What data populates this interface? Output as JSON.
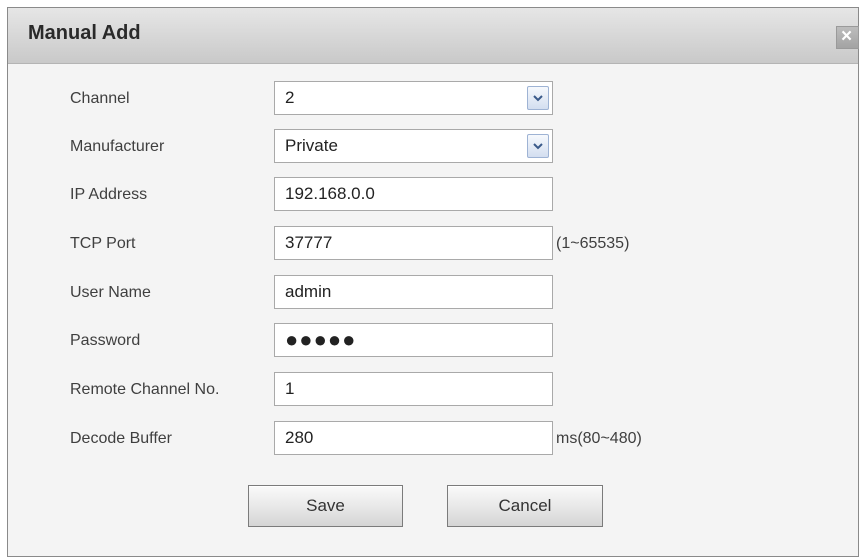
{
  "dialog": {
    "title": "Manual Add",
    "close_symbol": "×"
  },
  "form": {
    "channel": {
      "label": "Channel",
      "value": "2"
    },
    "manufacturer": {
      "label": "Manufacturer",
      "value": "Private"
    },
    "ip_address": {
      "label": "IP Address",
      "value": "192.168.0.0"
    },
    "tcp_port": {
      "label": "TCP Port",
      "value": "37777",
      "hint": "(1~65535)"
    },
    "user_name": {
      "label": "User Name",
      "value": "admin"
    },
    "password": {
      "label": "Password",
      "value": "●●●●●"
    },
    "remote_channel": {
      "label": "Remote Channel No.",
      "value": "1"
    },
    "decode_buffer": {
      "label": "Decode Buffer",
      "value": "280",
      "hint": "ms(80~480)"
    }
  },
  "buttons": {
    "save_label": "Save",
    "cancel_label": "Cancel"
  },
  "icons": {
    "dropdown": "chevron-down-icon",
    "close": "close-icon"
  },
  "colors": {
    "titlebar": "#d6d6d6",
    "dialog_bg": "#f4f4f4",
    "dropdown_button": "#d3def0"
  }
}
